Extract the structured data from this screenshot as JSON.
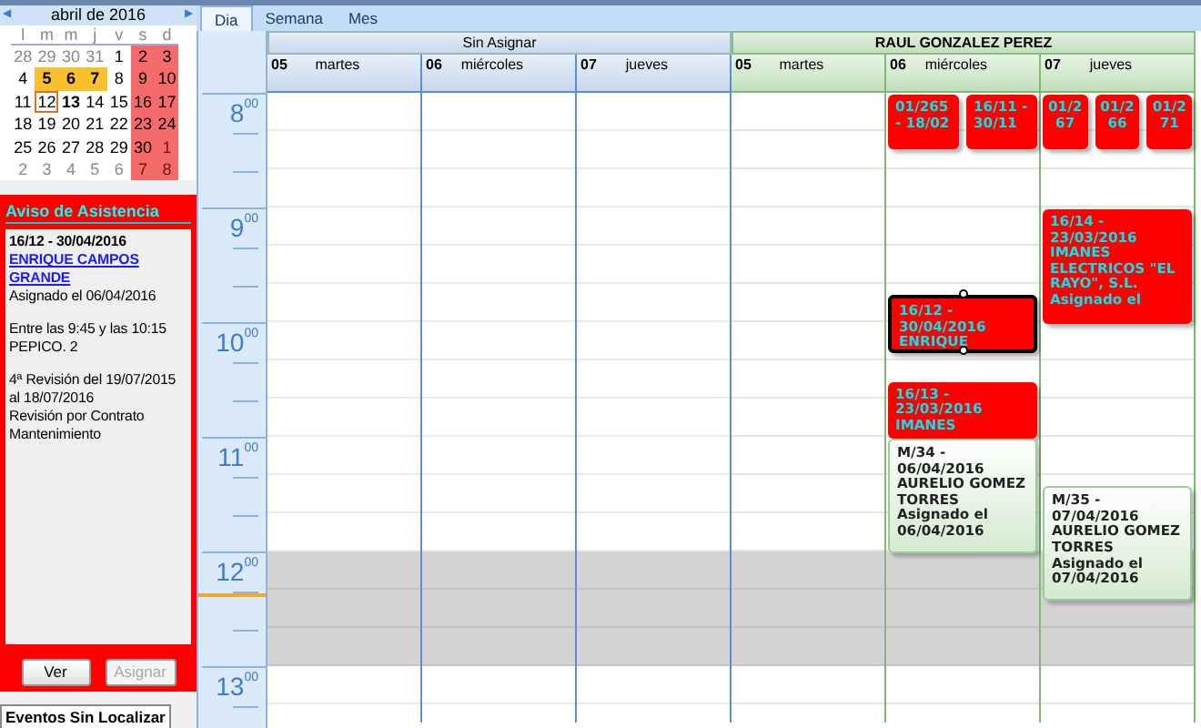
{
  "mini_calendar": {
    "title": "abril de 2016",
    "prev": "◀",
    "next": "▶",
    "weekdays": [
      "l",
      "m",
      "m",
      "j",
      "v",
      "s",
      "d"
    ],
    "weeks": [
      [
        {
          "d": "28",
          "other": true,
          "selected": false,
          "today": false,
          "bold": false
        },
        {
          "d": "29",
          "other": true,
          "selected": false,
          "today": false,
          "bold": false
        },
        {
          "d": "30",
          "other": true,
          "selected": false,
          "today": false,
          "bold": false
        },
        {
          "d": "31",
          "other": true,
          "selected": false,
          "today": false,
          "bold": false
        },
        {
          "d": "1",
          "other": false,
          "selected": false,
          "today": false,
          "bold": false
        },
        {
          "d": "2",
          "other": false,
          "selected": false,
          "today": false,
          "bold": false
        },
        {
          "d": "3",
          "other": false,
          "selected": false,
          "today": false,
          "bold": false
        }
      ],
      [
        {
          "d": "4",
          "other": false,
          "selected": false,
          "today": false,
          "bold": false
        },
        {
          "d": "5",
          "other": false,
          "selected": true,
          "today": false,
          "bold": true
        },
        {
          "d": "6",
          "other": false,
          "selected": true,
          "today": false,
          "bold": true
        },
        {
          "d": "7",
          "other": false,
          "selected": true,
          "today": false,
          "bold": true
        },
        {
          "d": "8",
          "other": false,
          "selected": false,
          "today": false,
          "bold": false
        },
        {
          "d": "9",
          "other": false,
          "selected": false,
          "today": false,
          "bold": false
        },
        {
          "d": "10",
          "other": false,
          "selected": false,
          "today": false,
          "bold": false
        }
      ],
      [
        {
          "d": "11",
          "other": false,
          "selected": false,
          "today": false,
          "bold": false
        },
        {
          "d": "12",
          "other": false,
          "selected": false,
          "today": true,
          "bold": false
        },
        {
          "d": "13",
          "other": false,
          "selected": false,
          "today": false,
          "bold": true
        },
        {
          "d": "14",
          "other": false,
          "selected": false,
          "today": false,
          "bold": false
        },
        {
          "d": "15",
          "other": false,
          "selected": false,
          "today": false,
          "bold": false
        },
        {
          "d": "16",
          "other": false,
          "selected": false,
          "today": false,
          "bold": false
        },
        {
          "d": "17",
          "other": false,
          "selected": false,
          "today": false,
          "bold": false
        }
      ],
      [
        {
          "d": "18",
          "other": false,
          "selected": false,
          "today": false,
          "bold": false
        },
        {
          "d": "19",
          "other": false,
          "selected": false,
          "today": false,
          "bold": false
        },
        {
          "d": "20",
          "other": false,
          "selected": false,
          "today": false,
          "bold": false
        },
        {
          "d": "21",
          "other": false,
          "selected": false,
          "today": false,
          "bold": false
        },
        {
          "d": "22",
          "other": false,
          "selected": false,
          "today": false,
          "bold": false
        },
        {
          "d": "23",
          "other": false,
          "selected": false,
          "today": false,
          "bold": false
        },
        {
          "d": "24",
          "other": false,
          "selected": false,
          "today": false,
          "bold": false
        }
      ],
      [
        {
          "d": "25",
          "other": false,
          "selected": false,
          "today": false,
          "bold": false
        },
        {
          "d": "26",
          "other": false,
          "selected": false,
          "today": false,
          "bold": false
        },
        {
          "d": "27",
          "other": false,
          "selected": false,
          "today": false,
          "bold": false
        },
        {
          "d": "28",
          "other": false,
          "selected": false,
          "today": false,
          "bold": false
        },
        {
          "d": "29",
          "other": false,
          "selected": false,
          "today": false,
          "bold": false
        },
        {
          "d": "30",
          "other": false,
          "selected": false,
          "today": false,
          "bold": false
        },
        {
          "d": "1",
          "other": true,
          "selected": false,
          "today": false,
          "bold": false
        }
      ],
      [
        {
          "d": "2",
          "other": true,
          "selected": false,
          "today": false,
          "bold": false
        },
        {
          "d": "3",
          "other": true,
          "selected": false,
          "today": false,
          "bold": false
        },
        {
          "d": "4",
          "other": true,
          "selected": false,
          "today": false,
          "bold": false
        },
        {
          "d": "5",
          "other": true,
          "selected": false,
          "today": false,
          "bold": false
        },
        {
          "d": "6",
          "other": true,
          "selected": false,
          "today": false,
          "bold": false
        },
        {
          "d": "7",
          "other": true,
          "selected": false,
          "today": false,
          "bold": false
        },
        {
          "d": "8",
          "other": true,
          "selected": false,
          "today": false,
          "bold": false
        }
      ]
    ]
  },
  "alert": {
    "title": "Aviso de Asistencia",
    "heading": "16/12 - 30/04/2016",
    "link": "ENRIQUE CAMPOS GRANDE",
    "paragraphs": [
      [
        "Asignado el 06/04/2016"
      ],
      [
        "Entre las 9:45 y las 10:15",
        "PEPICO. 2"
      ],
      [
        "4ª Revisión del 19/07/2015 al 18/07/2016",
        "Revisión por Contrato Mantenimiento"
      ]
    ],
    "buttons": [
      {
        "label": "Ver",
        "disabled": false
      },
      {
        "label": "Asignar",
        "disabled": true
      }
    ]
  },
  "bottom_tabs": [
    {
      "label": "Eventos Sin Localizar",
      "selected": true
    }
  ],
  "view_tabs": [
    {
      "label": "Dia",
      "selected": true
    },
    {
      "label": "Semana",
      "selected": false
    },
    {
      "label": "Mes",
      "selected": false
    }
  ],
  "hours": [
    {
      "hour": "8",
      "minutes": "00"
    },
    {
      "hour": "9",
      "minutes": "00"
    },
    {
      "hour": "10",
      "minutes": "00"
    },
    {
      "hour": "11",
      "minutes": "00"
    },
    {
      "hour": "12",
      "minutes": "00"
    },
    {
      "hour": "13",
      "minutes": "00"
    }
  ],
  "resources": [
    {
      "name": "Sin Asignar",
      "kind": "unassigned",
      "days": [
        {
          "num": "05",
          "weekday": "martes"
        },
        {
          "num": "06",
          "weekday": "miércoles"
        },
        {
          "num": "07",
          "weekday": "jueves"
        }
      ]
    },
    {
      "name": "RAUL GONZALEZ PEREZ",
      "kind": "person",
      "days": [
        {
          "num": "05",
          "weekday": "martes"
        },
        {
          "num": "06",
          "weekday": "miércoles",
          "events": [
            {
              "text": "01/265 - 18/02",
              "kind": "pending",
              "selected": false
            },
            {
              "text": "16/11 - 30/11",
              "kind": "pending",
              "selected": false
            },
            {
              "text": "16/12 - 30/04/2016 ENRIQUE",
              "kind": "pending",
              "selected": true
            },
            {
              "text": "16/13 - 23/03/2016 IMANES",
              "kind": "pending",
              "selected": false
            },
            {
              "text": "M/34 - 06/04/2016 AURELIO GOMEZ TORRES Asignado el 06/04/2016",
              "kind": "assigned",
              "selected": false
            }
          ]
        },
        {
          "num": "07",
          "weekday": "jueves",
          "events": [
            {
              "text": "01/267",
              "kind": "pending",
              "selected": false
            },
            {
              "text": "01/266",
              "kind": "pending",
              "selected": false
            },
            {
              "text": "01/271",
              "kind": "pending",
              "selected": false
            },
            {
              "text": "16/14 - 23/03/2016 IMANES ELECTRICOS \"EL RAYO\", S.L. Asignado el",
              "kind": "pending",
              "selected": false
            },
            {
              "text": "M/35 - 07/04/2016 AURELIO GOMEZ TORRES Asignado el 07/04/2016",
              "kind": "assigned",
              "selected": false
            }
          ]
        }
      ]
    }
  ]
}
